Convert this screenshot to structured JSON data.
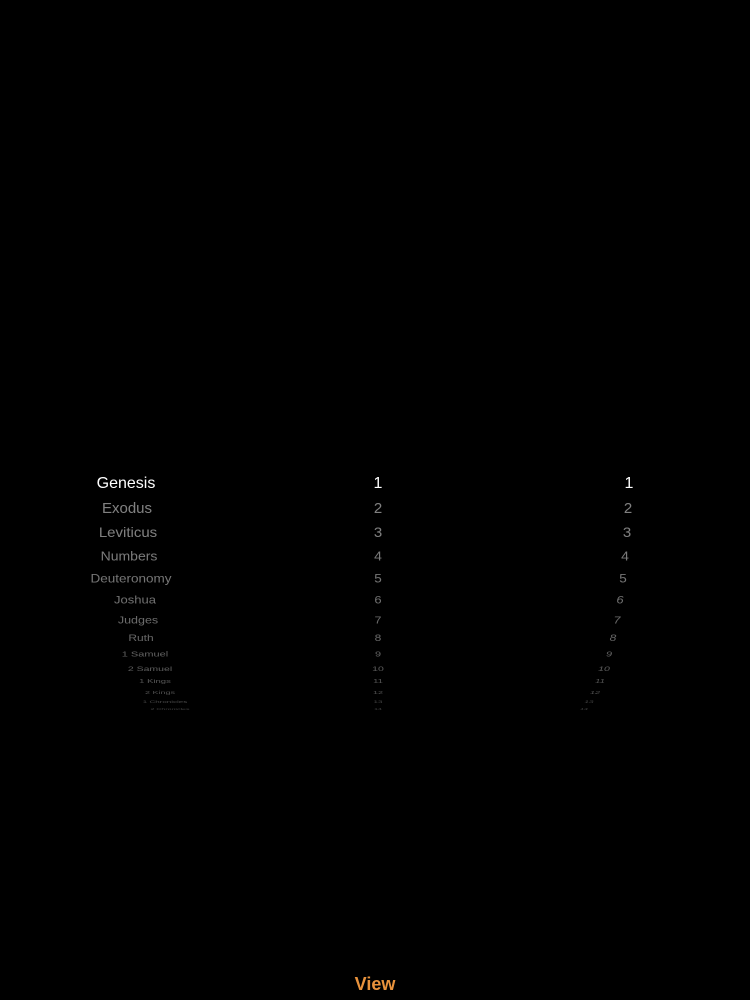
{
  "picker": {
    "books": [
      "Genesis",
      "Exodus",
      "Leviticus",
      "Numbers",
      "Deuteronomy",
      "Joshua",
      "Judges",
      "Ruth",
      "1 Samuel",
      "2 Samuel",
      "1 Kings",
      "2 Kings",
      "1 Chronicles",
      "2 Chronicles"
    ],
    "chapters": [
      "1",
      "2",
      "3",
      "4",
      "5",
      "6",
      "7",
      "8",
      "9",
      "10",
      "11",
      "12",
      "13",
      "14"
    ],
    "verses": [
      "1",
      "2",
      "3",
      "4",
      "5",
      "6",
      "7",
      "8",
      "9",
      "10",
      "11",
      "12",
      "13",
      "14"
    ],
    "selected_index": 0
  },
  "toolbar": {
    "view_label": "View"
  },
  "colors": {
    "background": "#000000",
    "selected_text": "#ffffff",
    "accent": "#e8923c"
  }
}
